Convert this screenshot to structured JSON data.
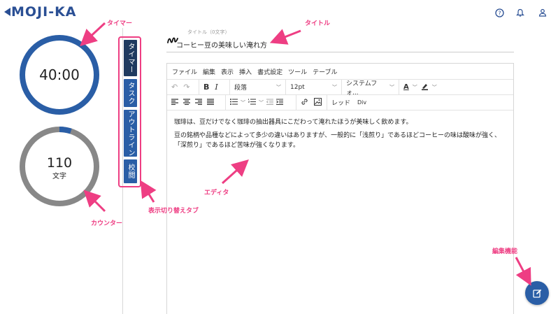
{
  "app": {
    "logo_text": "MOJI-KA"
  },
  "header": {
    "icons": [
      "help-icon",
      "bell-icon",
      "user-icon"
    ]
  },
  "timer": {
    "value": "40:00",
    "progress": 1.0,
    "color": "#2a5ea6"
  },
  "counter": {
    "value": "110",
    "unit": "文字",
    "progress": 0.05,
    "color": "#888888",
    "accent": "#2a5ea6"
  },
  "tabs": [
    {
      "label": "タイマー",
      "active": true
    },
    {
      "label": "タスク",
      "active": false
    },
    {
      "label": "アウトライン",
      "active": false
    },
    {
      "label": "校閲",
      "active": false
    }
  ],
  "title": {
    "hint": "タイトル（0文字）",
    "value": "コーヒー豆の美味しい淹れ方"
  },
  "editor": {
    "menu": [
      "ファイル",
      "編集",
      "表示",
      "挿入",
      "書式設定",
      "ツール",
      "テーブル"
    ],
    "block_format": "段落",
    "font_size": "12pt",
    "font_family": "システムフォ...",
    "extra": [
      "レッド",
      "Div"
    ],
    "paragraphs": [
      "珈琲は、豆だけでなく珈琲の抽出器具にこだわって淹れたほうが美味しく飲めます。",
      "豆の銘柄や品種などによって多少の違いはありますが、一般的に「浅煎り」であるほどコーヒーの味は酸味が強く、「深煎り」であるほど苦味が強くなります。"
    ]
  },
  "annotations": {
    "timer": "タイマー",
    "title": "タイトル",
    "tabs": "表示切り替えタブ",
    "editor": "エディタ",
    "counter": "カウンター",
    "edit": "編集機能"
  },
  "colors": {
    "brand": "#2a4f94",
    "accent": "#2a5ea6",
    "annotation": "#ee3e83"
  }
}
